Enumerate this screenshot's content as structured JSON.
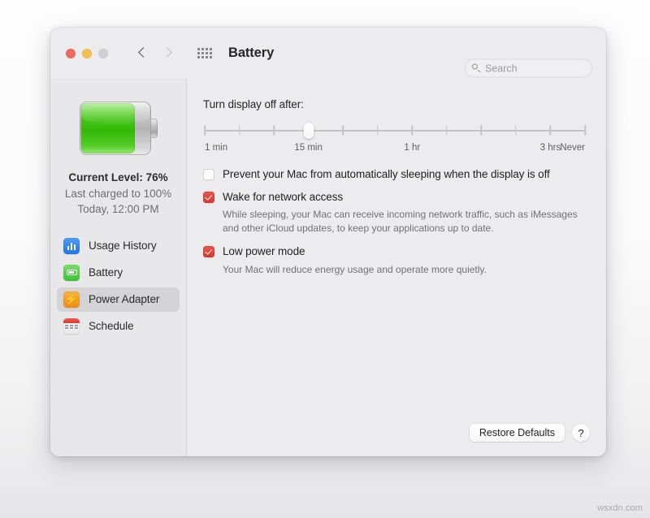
{
  "window": {
    "title": "Battery",
    "traffic_lights": [
      {
        "name": "close",
        "color": "#ee6a5f"
      },
      {
        "name": "minimize",
        "color": "#f5bd4f"
      },
      {
        "name": "zoom",
        "color": "#cfcfd2"
      }
    ],
    "nav": {
      "back": "back-chevron",
      "forward": "forward-chevron"
    },
    "grid_button": "show-all-preferences",
    "search": {
      "placeholder": "Search",
      "value": "",
      "icon": "search-icon"
    }
  },
  "sidebar": {
    "battery": {
      "level_percent": 76,
      "level_text": "Current Level: 76%",
      "last_charged": "Last charged to 100%",
      "last_charged_time": "Today, 12:00 PM"
    },
    "items": [
      {
        "label": "Usage History",
        "icon": "usage-history-icon",
        "selected": false
      },
      {
        "label": "Battery",
        "icon": "battery-icon",
        "selected": false
      },
      {
        "label": "Power Adapter",
        "icon": "power-adapter-icon",
        "selected": true
      },
      {
        "label": "Schedule",
        "icon": "schedule-icon",
        "selected": false
      }
    ]
  },
  "main": {
    "slider": {
      "label": "Turn display off after:",
      "value_index": 3,
      "tick_count": 12,
      "tick_labels": [
        {
          "text": "1 min",
          "pos": 0
        },
        {
          "text": "15 min",
          "pos": 3
        },
        {
          "text": "1 hr",
          "pos": 6
        },
        {
          "text": "3 hrs",
          "pos": 10
        },
        {
          "text": "Never",
          "pos": 11
        }
      ]
    },
    "options": [
      {
        "label": "Prevent your Mac from automatically sleeping when the display is off",
        "checked": false,
        "helper": ""
      },
      {
        "label": "Wake for network access",
        "checked": true,
        "helper": "While sleeping, your Mac can receive incoming network traffic, such as iMessages and other iCloud updates, to keep your applications up to date."
      },
      {
        "label": "Low power mode",
        "checked": true,
        "helper": "Your Mac will reduce energy usage and operate more quietly."
      }
    ],
    "buttons": {
      "restore_defaults": "Restore Defaults",
      "help": "?"
    }
  },
  "watermark": "wsxdn.com",
  "colors": {
    "checkbox_accent": "#d8372b",
    "battery_fill": "#3cc335",
    "window_bg": "#ececee",
    "sidebar_bg": "#e8e8ea",
    "selection": "#d4d4d7"
  }
}
